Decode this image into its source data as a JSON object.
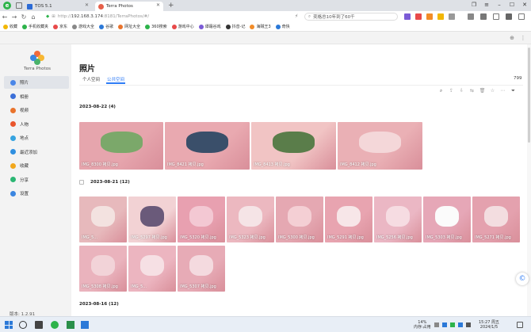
{
  "browser": {
    "tabs": [
      {
        "label": "TOS 5.1"
      },
      {
        "label": "Terra Photos"
      }
    ],
    "url_prefix": "http://",
    "url_host": "192.168.3.174",
    "url_path": ":8181/TerraPhotos/#/",
    "search_text": "奕格总10年到了60千",
    "bookmarks": [
      "收藏",
      "手机收藏夹",
      "京东",
      "游戏大全",
      "谷歌",
      "网址大全",
      "360搜索",
      "游戏中心",
      "谭霜谷戏",
      "抖音-记",
      "海贼王3",
      "奇快"
    ]
  },
  "app": {
    "name": "Terra Photos",
    "version": "版本: 1.2.91",
    "nav": [
      {
        "label": "照片",
        "color": "#4a86e8"
      },
      {
        "label": "相册",
        "color": "#3b6fd8"
      },
      {
        "label": "视频",
        "color": "#e9732c"
      },
      {
        "label": "人物",
        "color": "#e9552c"
      },
      {
        "label": "地点",
        "color": "#36a3e0"
      },
      {
        "label": "最近添加",
        "color": "#2f8fe0"
      },
      {
        "label": "收藏",
        "color": "#f2a81d"
      },
      {
        "label": "分享",
        "color": "#2bb673"
      },
      {
        "label": "设置",
        "color": "#3b86e0"
      }
    ]
  },
  "page": {
    "title": "照片",
    "tabs": [
      "个人空间",
      "公共空间"
    ],
    "count": "799"
  },
  "groups": [
    {
      "date": "2023-08-22 (4)",
      "photos": [
        {
          "name": "IMG_8300 拷贝.jpg",
          "bg": "#e6a5ad",
          "accent": "#7ba86a"
        },
        {
          "name": "IMG_8421 拷贝.jpg",
          "bg": "#e9a9b0",
          "accent": "#3a4f6a"
        },
        {
          "name": "IMG_8413 拷贝.jpg",
          "bg": "#f1c4c4",
          "accent": "#5a7d4a"
        },
        {
          "name": "IMG_8412 拷贝.jpg",
          "bg": "#eab0b5",
          "accent": "#f4d7d9"
        }
      ]
    },
    {
      "date": "2023-08-21 (12)",
      "photos": [
        {
          "name": "IMG_5...",
          "bg": "#e7b9bc",
          "accent": "#f3e2e0"
        },
        {
          "name": "IMG_5297 拷贝.jpg",
          "bg": "#f2d2d4",
          "accent": "#6a5a7a"
        },
        {
          "name": "IMG_5320 拷贝.jpg",
          "bg": "#e8a0b0",
          "accent": "#f3c8d3"
        },
        {
          "name": "IMG_5323 拷贝.jpg",
          "bg": "#ecb8c0",
          "accent": "#f5e4e6"
        },
        {
          "name": "IMG_5300 拷贝.jpg",
          "bg": "#e5a8b2",
          "accent": "#f4cfd4"
        },
        {
          "name": "IMG_5291 拷贝.jpg",
          "bg": "#e8a4b0",
          "accent": "#f7e6e8"
        },
        {
          "name": "IMG_5256 拷贝.jpg",
          "bg": "#ebb7c4",
          "accent": "#f6dce2"
        },
        {
          "name": "IMG_5303 拷贝.jpg",
          "bg": "#e6a7b7",
          "accent": "#fbfbfb"
        },
        {
          "name": "IMG_5271 拷贝.jpg",
          "bg": "#e4a1ae",
          "accent": "#f3dde0"
        },
        {
          "name": "IMG_5308 拷贝.jpg",
          "bg": "#eab3bd",
          "accent": "#f2d3d8"
        },
        {
          "name": "IMG_5...",
          "bg": "#ecb5c0",
          "accent": "#f6e0e4"
        },
        {
          "name": "IMG_5307 拷贝.jpg",
          "bg": "#e7abb6",
          "accent": "#f4dadf"
        }
      ]
    },
    {
      "date": "2023-08-16 (12)",
      "photos": []
    }
  ],
  "taskbar": {
    "cpu": "14%",
    "mem": "内存:占用",
    "time": "15:27 周五",
    "date": "2024/1/5"
  }
}
